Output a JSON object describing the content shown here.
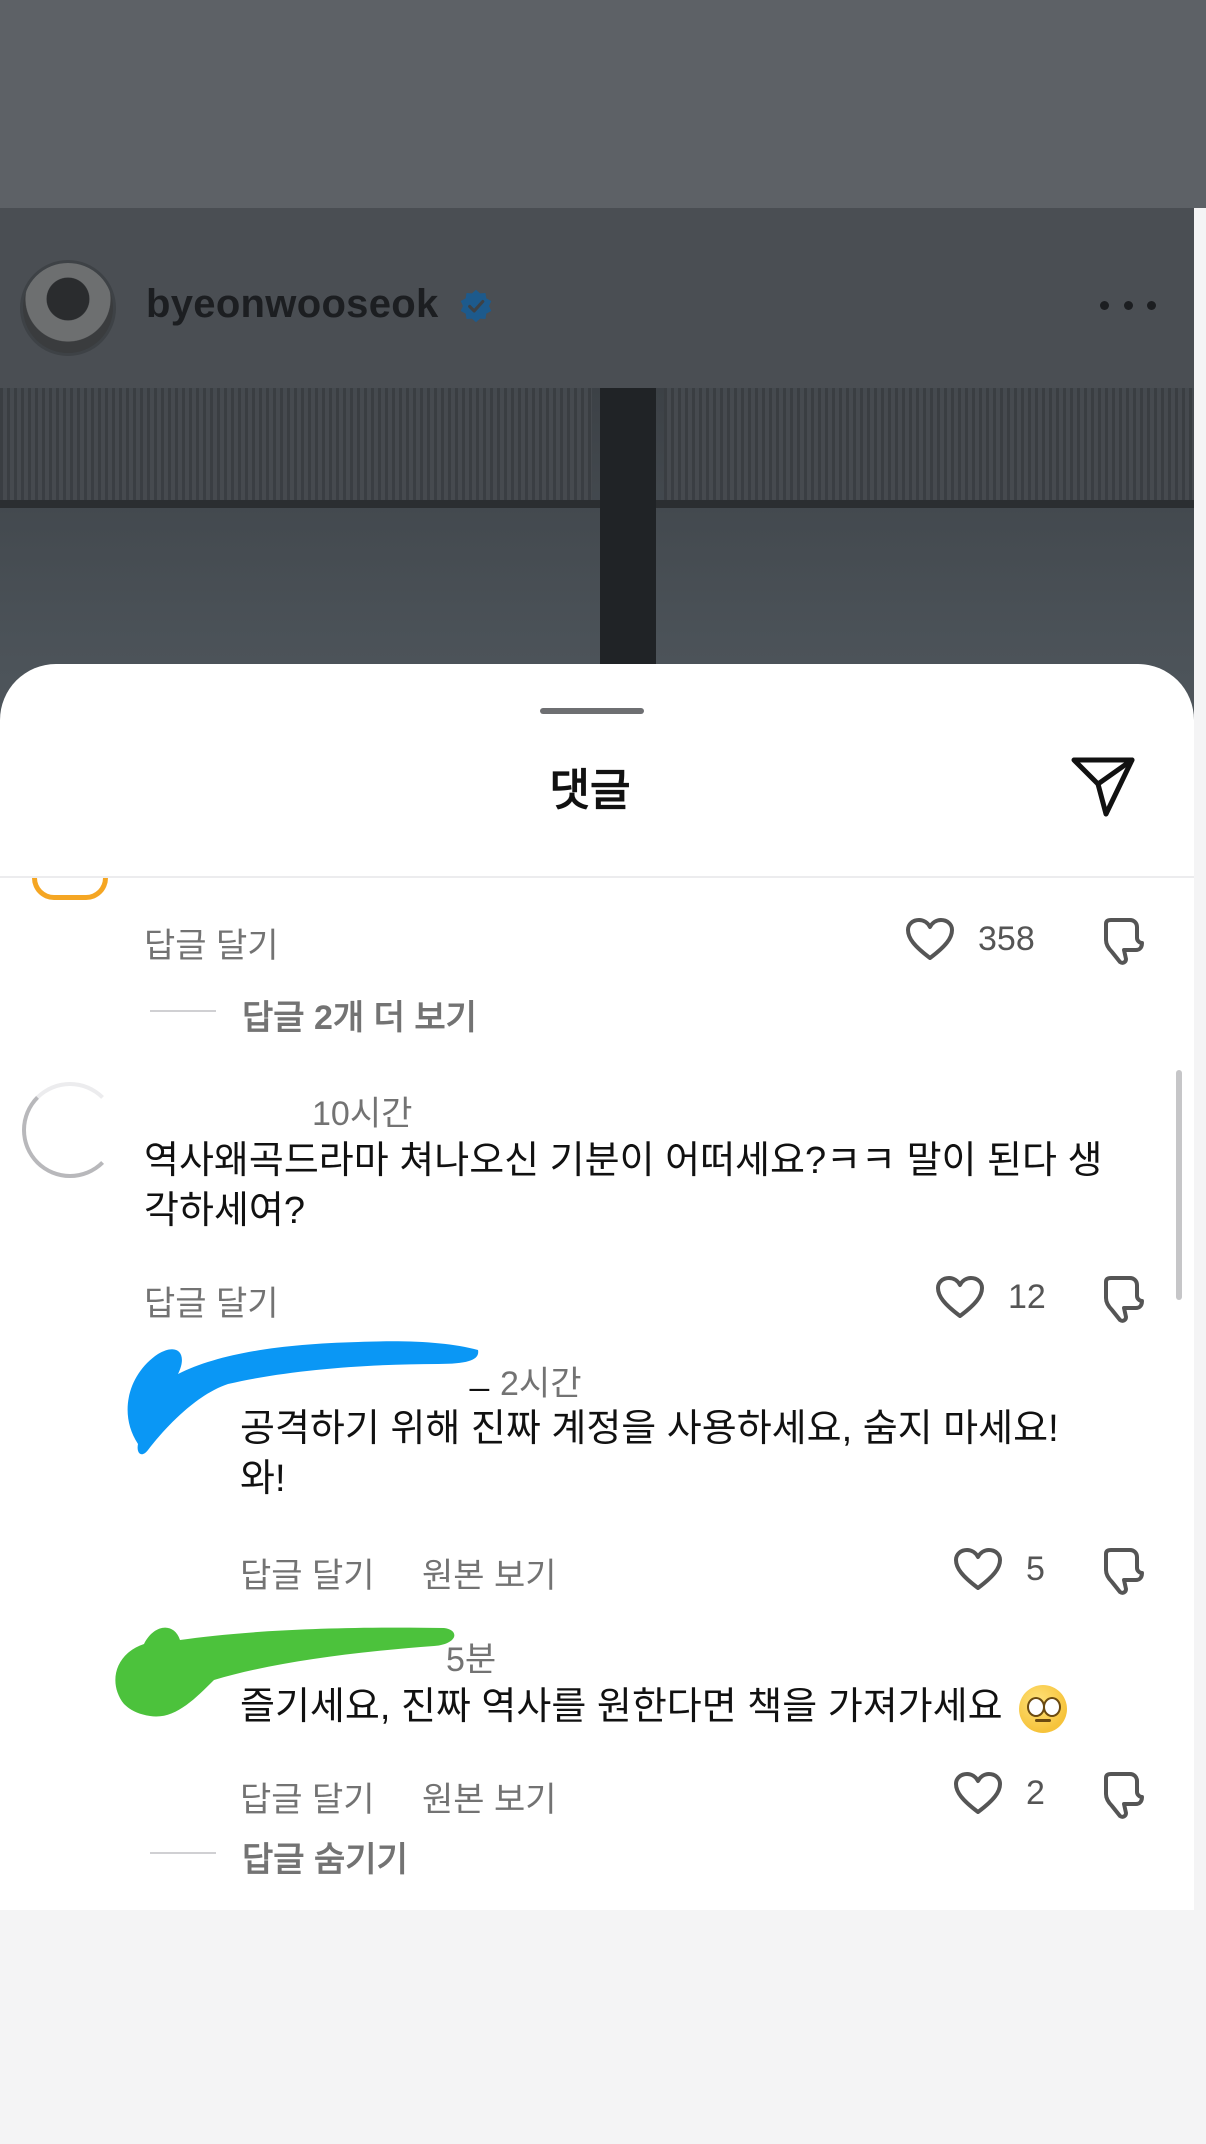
{
  "post": {
    "username": "byeonwooseok"
  },
  "sheet": {
    "title": "댓글"
  },
  "comments": {
    "first": {
      "reply_label": "답글 달기",
      "likes": "358",
      "more_replies": "답글 2개 더 보기"
    },
    "second": {
      "time": "10시간",
      "text_line1": "역사왜곡드라마 쳐나오신 기분이 어떠세요?ㅋㅋ 말이 된다 생",
      "text_line2": "각하세여?",
      "reply_label": "답글 달기",
      "likes": "12"
    },
    "reply1": {
      "username_suffix": "_",
      "time": "2시간",
      "text_line1": "공격하기 위해 진짜 계정을 사용하세요, 숨지 마세요!",
      "text_line2": "와!",
      "reply_label": "답글 달기",
      "original_label": "원본 보기",
      "likes": "5"
    },
    "reply2": {
      "time": "5분",
      "text": "즐기세요, 진짜 역사를 원한다면 책을 가져가세요",
      "emoji": "face-with-rolling-eyes",
      "reply_label": "답글 달기",
      "original_label": "원본 보기",
      "likes": "2"
    },
    "hide_replies": "답글 숨기기"
  },
  "colors": {
    "verified": "#0095f6",
    "scribble_blue": "#0a97f5",
    "scribble_green": "#4cc23c",
    "dim_bg": "#5d6166"
  }
}
